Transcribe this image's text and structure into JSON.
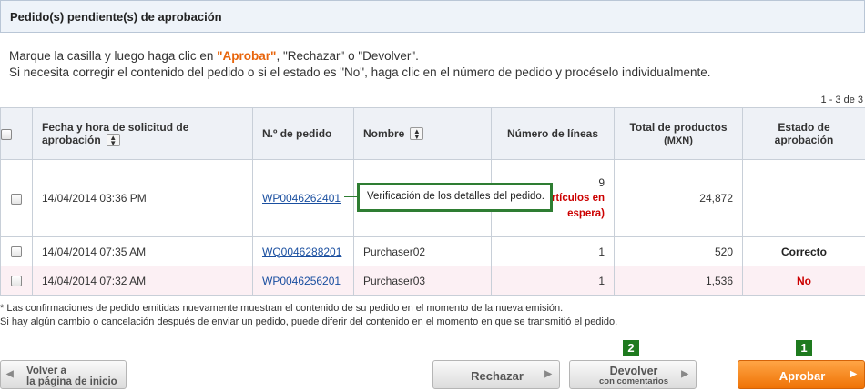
{
  "panel": {
    "title": "Pedido(s) pendiente(s) de aprobación"
  },
  "instructions": {
    "line1_pre": "Marque la casilla y luego haga clic en ",
    "line1_highlight": "\"Aprobar\"",
    "line1_post": ", \"Rechazar\" o \"Devolver\".",
    "line2": "Si necesita corregir el contenido del pedido o si el estado es \"No\", haga clic en el número de pedido y procéselo individualmente.",
    "highlight_color": "#e8650c"
  },
  "pagination": {
    "range": "1 - 3 de 3"
  },
  "table": {
    "headers": {
      "request_date_1": "Fecha y hora de solicitud de",
      "request_date_2": "aprobación",
      "order_no": "N.º de pedido",
      "name": "Nombre",
      "lines": "Número de líneas",
      "total_1": "Total de productos",
      "total_2": "(MXN)",
      "status_1": "Estado de",
      "status_2": "aprobación"
    },
    "rows": [
      {
        "date": "14/04/2014 03:36 PM",
        "order_no": "WP0046262401",
        "name": "",
        "lines": "9",
        "lines_note_1": "(Artículos en",
        "lines_note_2": "espera)",
        "total": "24,872",
        "status": ""
      },
      {
        "date": "14/04/2014 07:35 AM",
        "order_no": "WQ0046288201",
        "name": "Purchaser02",
        "lines": "1",
        "total": "520",
        "status": "Correcto"
      },
      {
        "date": "14/04/2014 07:32 AM",
        "order_no": "WP0046256201",
        "name": "Purchaser03",
        "lines": "1",
        "total": "1,536",
        "status": "No"
      }
    ]
  },
  "tooltip": {
    "text": "Verificación de los detalles del pedido.",
    "border_color": "#2e7d32"
  },
  "notes": {
    "line1": "* Las confirmaciones de pedido emitidas nuevamente muestran el contenido de su pedido en el momento de la nueva emisión.",
    "line2": "Si hay algún cambio o cancelación después de enviar un pedido, puede diferir del contenido en el momento en que se transmitió el pedido."
  },
  "buttons": {
    "back_1": "Volver a",
    "back_2": "la página de inicio",
    "reject": "Rechazar",
    "return": "Devolver",
    "return_sub": "con comentarios",
    "approve": "Aprobar",
    "approve_color": "#ef7306"
  },
  "steps": {
    "approve": "1",
    "return": "2",
    "color": "#1e7a1e"
  }
}
